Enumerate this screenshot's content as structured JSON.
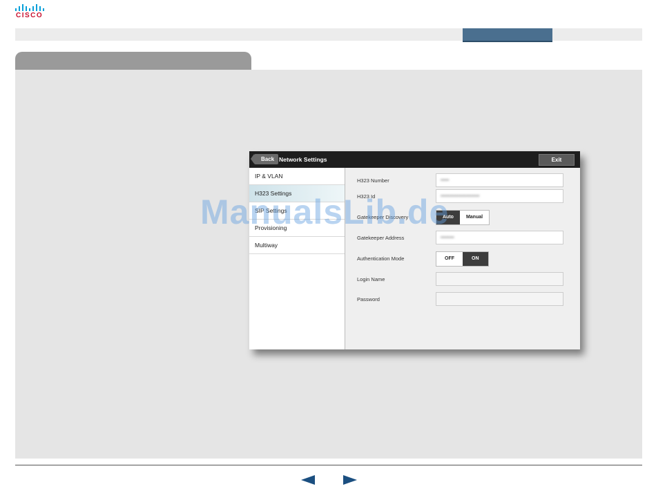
{
  "brand": {
    "logo_text": "CISCO"
  },
  "topbar": {
    "active_tab_label": ""
  },
  "section_tab": {
    "label": ""
  },
  "device": {
    "back_label": "Back",
    "title": "Network Settings",
    "exit_label": "Exit",
    "menu": [
      {
        "label": "IP & VLAN",
        "active": false
      },
      {
        "label": "H323 Settings",
        "active": true
      },
      {
        "label": "SIP Settings",
        "active": false
      },
      {
        "label": "Provisioning",
        "active": false
      },
      {
        "label": "Multiway",
        "active": false
      }
    ],
    "fields": {
      "h323_number": {
        "label": "H323 Number",
        "value": "•••••"
      },
      "h323_id": {
        "label": "H323 Id",
        "value": "•••••••••••••••••••••••"
      },
      "gatekeeper_discovery": {
        "label": "Gatekeeper Discovery",
        "options": [
          "Auto",
          "Manual"
        ],
        "selected": "Auto"
      },
      "gatekeeper_address": {
        "label": "Gatekeeper Address",
        "value": "••••••••"
      },
      "authentication_mode": {
        "label": "Authentication Mode",
        "options": [
          "OFF",
          "ON"
        ],
        "selected": "ON"
      },
      "login_name": {
        "label": "Login Name",
        "value": ""
      },
      "password": {
        "label": "Password",
        "value": ""
      }
    }
  },
  "watermark": "ManualsLib.de",
  "colors": {
    "accent": "#4a6f8f",
    "nav_arrow": "#1b4f80",
    "logo": "#c8102e"
  }
}
